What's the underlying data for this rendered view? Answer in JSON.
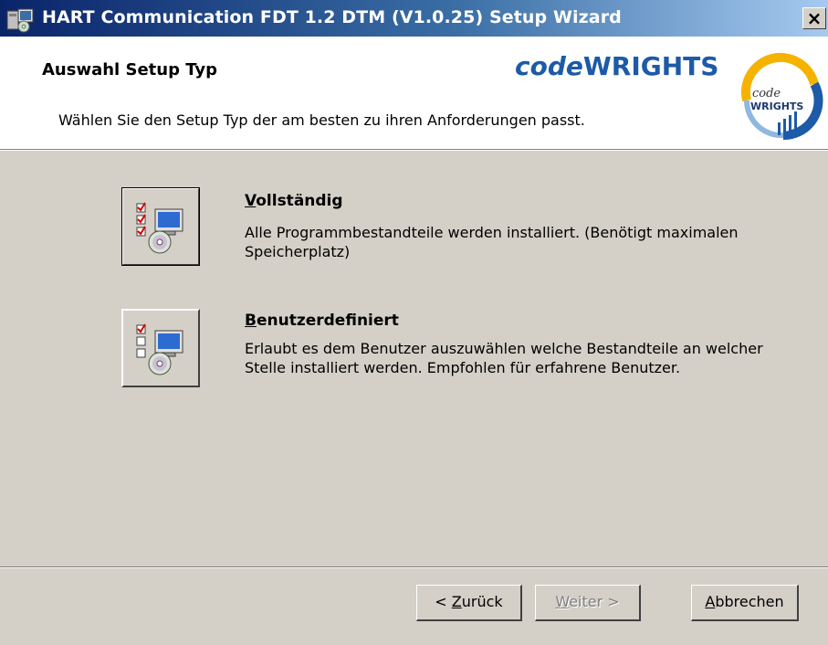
{
  "window": {
    "title": "HART Communication FDT 1.2 DTM (V1.0.25) Setup Wizard",
    "close_label": "×"
  },
  "header": {
    "title": "Auswahl Setup Typ",
    "subtitle": "Wählen Sie den Setup Typ der am besten zu ihren Anforderungen passt.",
    "brand_prefix": "code",
    "brand_suffix": "WRIGHTS",
    "badge_top": "code",
    "badge_bottom": "WRIGHTS"
  },
  "options": [
    {
      "title_mnemonic": "V",
      "title_rest": "ollständig",
      "description": "Alle Programmbestandteile werden installiert. (Benötigt maximalen Speicherplatz)"
    },
    {
      "title_mnemonic": "B",
      "title_rest": "enutzerdefiniert",
      "description": "Erlaubt es dem Benutzer auszuwählen welche Bestandteile an welcher Stelle installiert werden. Empfohlen für erfahrene Benutzer."
    }
  ],
  "footer": {
    "back": {
      "prefix": "< ",
      "mnemonic": "Z",
      "rest": "urück",
      "enabled": true
    },
    "next": {
      "mnemonic": "W",
      "rest": "eiter >",
      "enabled": false
    },
    "cancel": {
      "mnemonic": "A",
      "rest": "bbrechen",
      "enabled": true
    }
  },
  "colors": {
    "titlebar_start": "#0a246a",
    "titlebar_end": "#a6caf0",
    "brand_blue": "#1d5aa8",
    "dialog_bg": "#d4d0c8"
  }
}
